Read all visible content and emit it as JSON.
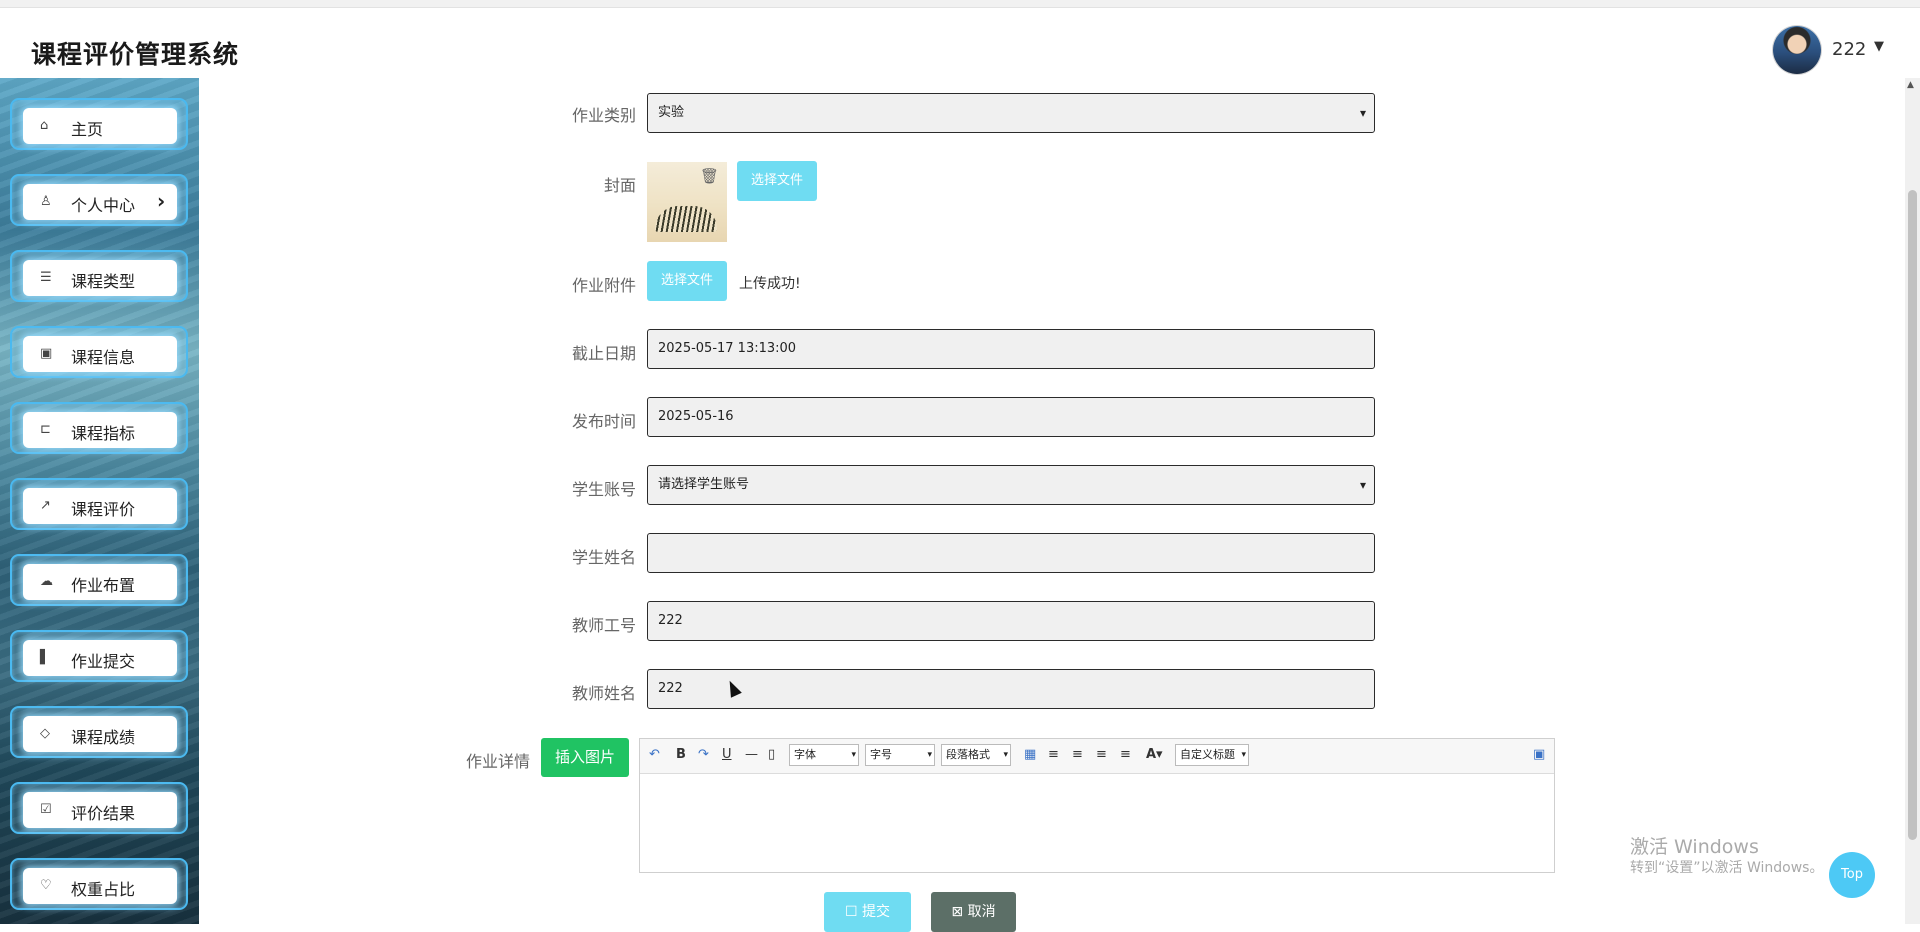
{
  "header": {
    "title": "课程评价管理系统",
    "user": "222"
  },
  "sidebar": {
    "items": [
      {
        "icon": "⌂",
        "label": "主页"
      },
      {
        "icon": "♙",
        "label": "个人中心",
        "arrow": "›"
      },
      {
        "icon": "☰",
        "label": "课程类型"
      },
      {
        "icon": "▣",
        "label": "课程信息"
      },
      {
        "icon": "⊏",
        "label": "课程指标"
      },
      {
        "icon": "↗",
        "label": "课程评价"
      },
      {
        "icon": "☁",
        "label": "作业布置"
      },
      {
        "icon": "▌",
        "label": "作业提交"
      },
      {
        "icon": "◇",
        "label": "课程成绩"
      },
      {
        "icon": "☑",
        "label": "评价结果"
      },
      {
        "icon": "♡",
        "label": "权重占比"
      }
    ]
  },
  "form": {
    "category": {
      "label": "作业类别",
      "value": "实验"
    },
    "cover": {
      "label": "封面",
      "button": "选择文件"
    },
    "attachment": {
      "label": "作业附件",
      "button": "选择文件",
      "status": "上传成功!"
    },
    "deadline": {
      "label": "截止日期",
      "value": "2025-05-17 13:13:00"
    },
    "publish": {
      "label": "发布时间",
      "value": "2025-05-16"
    },
    "student_account": {
      "label": "学生账号",
      "value": "请选择学生账号"
    },
    "student_name": {
      "label": "学生姓名",
      "value": ""
    },
    "teacher_id": {
      "label": "教师工号",
      "value": "222"
    },
    "teacher_name": {
      "label": "教师姓名",
      "value": "222"
    },
    "details": {
      "label": "作业详情",
      "insert_button": "插入图片"
    }
  },
  "editor": {
    "font": "字体",
    "size": "字号",
    "paragraph": "段落格式",
    "custom": "自定义标题"
  },
  "actions": {
    "submit": "提交",
    "cancel": "取消",
    "top": "Top"
  },
  "watermark": {
    "line1": "激活 Windows",
    "line2": "转到“设置”以激活 Windows。"
  }
}
